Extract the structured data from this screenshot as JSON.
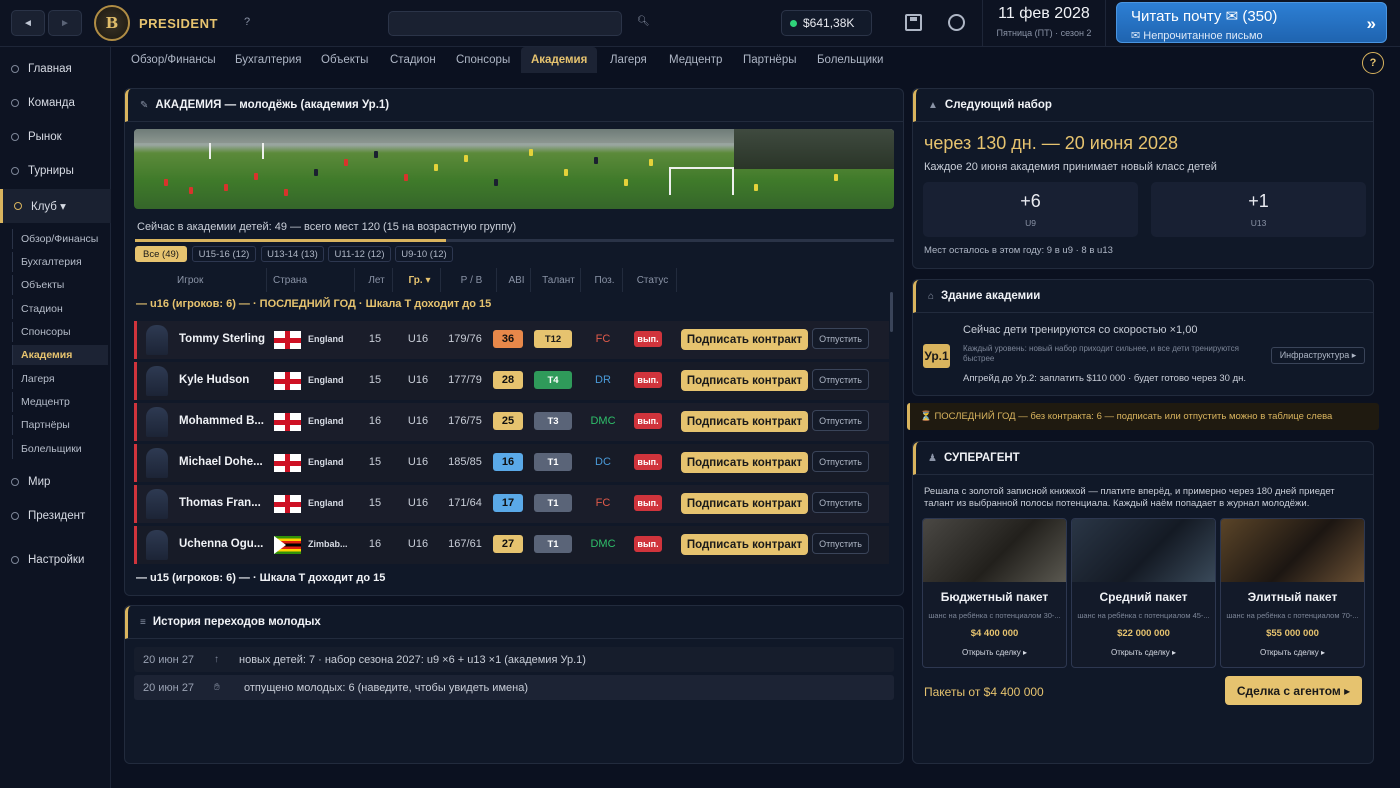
{
  "topbar": {
    "brand": "PRESIDENT",
    "logo_letter": "B",
    "back": "◄",
    "forward": "►",
    "help": "?",
    "balance": "$641,38K",
    "date": "11 фев 2028",
    "date_sub": "Пятница (ПТ) · сезон 2",
    "mail_title": "Читать почту ✉ (350)",
    "mail_sub": "✉ Непрочитанное письмо",
    "mail_arrow": "»"
  },
  "sidebar": {
    "items": [
      "Главная",
      "Команда",
      "Рынок",
      "Турниры",
      "Клуб ▾",
      "Мир",
      "Президент",
      "Настройки"
    ],
    "subitems": [
      "Обзор/Финансы",
      "Бухгалтерия",
      "Объекты",
      "Стадион",
      "Спонсоры",
      "Академия",
      "Лагеря",
      "Медцентр",
      "Партнёры",
      "Болельщики"
    ]
  },
  "tabs": [
    "Обзор/Финансы",
    "Бухгалтерия",
    "Объекты",
    "Стадион",
    "Спонсоры",
    "Академия",
    "Лагеря",
    "Медцентр",
    "Партнёры",
    "Болельщики"
  ],
  "qmark": "?",
  "academy": {
    "title": "АКАДЕМИЯ — молодёжь (академия Ур.1)",
    "kids_count": "Сейчас в академии детей: 49 — всего мест 120 (15 на возрастную группу)",
    "fill_fraction": 0.41,
    "chips": [
      "Все (49)",
      "U15-16 (12)",
      "U13-14 (13)",
      "U11-12 (12)",
      "U9-10 (12)"
    ],
    "headers": [
      "Игрок",
      "Страна",
      "Лет",
      "Гр. ▾",
      "Р / В",
      "ABI",
      "Талант",
      "Поз.",
      "Статус"
    ],
    "group1": "— u16 (игроков: 6) — · ПОСЛЕДНИЙ ГОД · Шкала T доходит до 15",
    "group2": "— u15 (игроков: 6) — · Шкала T доходит до 15",
    "sign_label": "Подписать контракт",
    "release_label": "Отпустить",
    "players": [
      {
        "name": "Tommy Sterling",
        "country": "England",
        "flag": "eng",
        "age": "15",
        "group": "U16",
        "hw": "179/76",
        "abi": "36",
        "abi_color": "#e8884a",
        "talent": "T12",
        "talent_bg": "#e6c36f",
        "talent_fg": "#1a1a1a",
        "pos": "FC",
        "pos_color": "#e05a4a",
        "status": "вып."
      },
      {
        "name": "Kyle Hudson",
        "country": "England",
        "flag": "eng",
        "age": "15",
        "group": "U16",
        "hw": "177/79",
        "abi": "28",
        "abi_color": "#e6c36f",
        "talent": "T4",
        "talent_bg": "#2f9a5a",
        "talent_fg": "#ffffff",
        "pos": "DR",
        "pos_color": "#4a9ad8",
        "status": "вып."
      },
      {
        "name": "Mohammed B...",
        "country": "England",
        "flag": "eng",
        "age": "16",
        "group": "U16",
        "hw": "176/75",
        "abi": "25",
        "abi_color": "#e6c36f",
        "talent": "T3",
        "talent_bg": "#5a6478",
        "talent_fg": "#ffffff",
        "pos": "DMC",
        "pos_color": "#2fbf6a",
        "status": "вып."
      },
      {
        "name": "Michael Dohe...",
        "country": "England",
        "flag": "eng",
        "age": "15",
        "group": "U16",
        "hw": "185/85",
        "abi": "16",
        "abi_color": "#5aa9e8",
        "talent": "T1",
        "talent_bg": "#5a6478",
        "talent_fg": "#ffffff",
        "pos": "DC",
        "pos_color": "#4a9ad8",
        "status": "вып."
      },
      {
        "name": "Thomas Fran...",
        "country": "England",
        "flag": "eng",
        "age": "15",
        "group": "U16",
        "hw": "171/64",
        "abi": "17",
        "abi_color": "#5aa9e8",
        "talent": "T1",
        "talent_bg": "#5a6478",
        "talent_fg": "#ffffff",
        "pos": "FC",
        "pos_color": "#e05a4a",
        "status": "вып."
      },
      {
        "name": "Uchenna Ogu...",
        "country": "Zimbab...",
        "flag": "zim",
        "age": "16",
        "group": "U16",
        "hw": "167/61",
        "abi": "27",
        "abi_color": "#e6c36f",
        "talent": "T1",
        "talent_bg": "#5a6478",
        "talent_fg": "#ffffff",
        "pos": "DMC",
        "pos_color": "#2fbf6a",
        "status": "вып."
      }
    ]
  },
  "history": {
    "title": "История переходов молодых",
    "rows": [
      {
        "date": "20 июн 27",
        "text": "новых детей: 7 · набор сезона 2027: u9 ×6 + u13 ×1 (академия Ур.1)"
      },
      {
        "date": "20 июн 27",
        "text": "отпущено молодых: 6 (наведите, чтобы увидеть имена)"
      }
    ]
  },
  "intake": {
    "title": "Следующий набор",
    "countdown": "через 130 дн. — 20 июня 2028",
    "desc": "Каждое 20 июня академия принимает новый класс детей",
    "stats": [
      {
        "value": "+6",
        "label": "U9"
      },
      {
        "value": "+1",
        "label": "U13"
      }
    ],
    "remaining": "Мест осталось в этом году: 9 в u9 · 8 в u13"
  },
  "building": {
    "title": "Здание академии",
    "speed": "Сейчас дети тренируются со скоростью ×1,00",
    "level": "Ур.1",
    "level_desc": "Каждый уровень: новый набор приходит сильнее, и все дети тренируются быстрее",
    "upgrade": "Апгрейд до Ур.2: заплатить $110 000 · будет готово через 30 дн.",
    "infra_button": "Инфраструктура ▸"
  },
  "warning": "⏳ ПОСЛЕДНИЙ ГОД — без контракта: 6 — подписать или отпустить можно в таблице слева",
  "superagent": {
    "title": "СУПЕРАГЕНТ",
    "desc": "Решала с золотой записной книжкой — платите вперёд, и примерно через 180 дней приедет талант из выбранной полосы потенциала. Каждый наём попадает в журнал молодёжи.",
    "packs": [
      {
        "title": "Бюджетный пакет",
        "desc": "шанс на ребёнка с потенциалом 30-...",
        "price": "$4 400 000",
        "link": "Открыть сделку ▸"
      },
      {
        "title": "Средний пакет",
        "desc": "шанс на ребёнка с потенциалом 45-...",
        "price": "$22 000 000",
        "link": "Открыть сделку ▸"
      },
      {
        "title": "Элитный пакет",
        "desc": "шанс на ребёнка с потенциалом 70-...",
        "price": "$55 000 000",
        "link": "Открыть сделку ▸"
      }
    ],
    "from_price": "Пакеты от $4 400 000",
    "agent_button": "Сделка с агентом ▸"
  }
}
